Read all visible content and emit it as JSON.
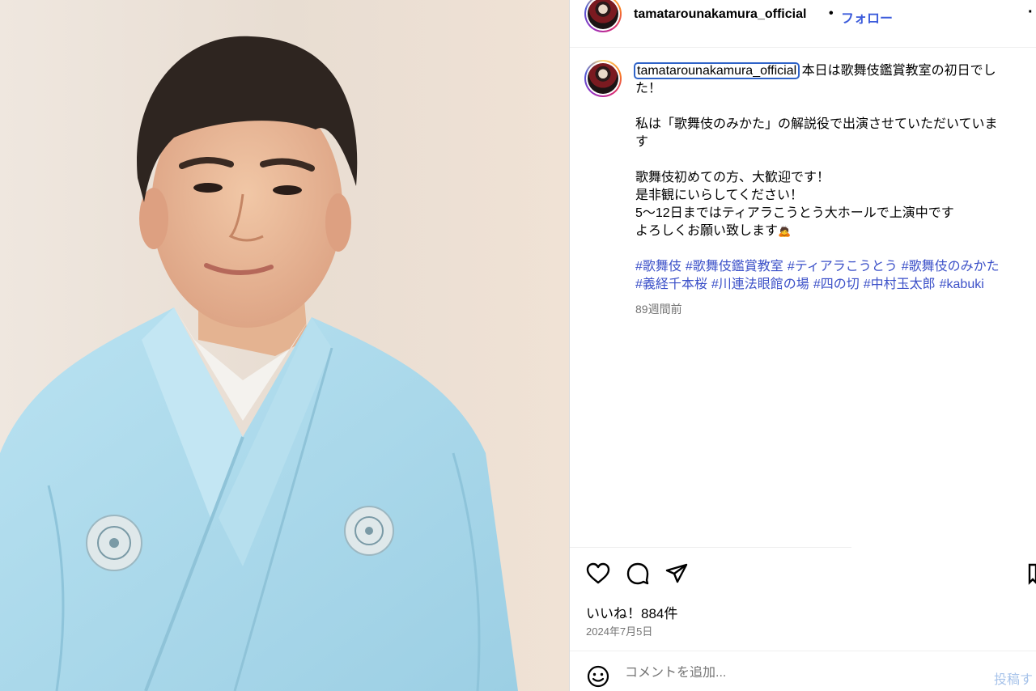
{
  "post": {
    "username": "tamatarounakamura_official",
    "follow_label": "フォロー",
    "more_icon": "more-icon",
    "caption_lines": [
      "本日は歌舞伎鑑賞教室の初日でし",
      "た！",
      "私は「歌舞伎のみかた」の解説役で出演させていただいていま",
      "す",
      "歌舞伎初めての方、大歓迎です！",
      "是非観にいらしてください！",
      "5〜12日まではティアラこうとう大ホールで上演中です",
      "よろしくお願い致します"
    ],
    "caption_emoji": "🙇",
    "hashtags_line1": [
      "#歌舞伎",
      "#歌舞伎鑑賞教室",
      "#ティアラこうとう",
      "#歌舞伎のみかた"
    ],
    "hashtags_line2": [
      "#義経千本桜",
      "#川連法眼館の場",
      "#四の切",
      "#中村玉太郎",
      "#kabuki"
    ],
    "time_ago": "89週間前",
    "likes": "いいね！884件",
    "date": "2024年7月5日",
    "comment_placeholder": "コメントを追加...",
    "post_label": "投稿す"
  },
  "colors": {
    "link": "#3b50c8",
    "follow": "#3b5bdb",
    "muted": "#737373",
    "kimono": "#a9d7e9"
  }
}
